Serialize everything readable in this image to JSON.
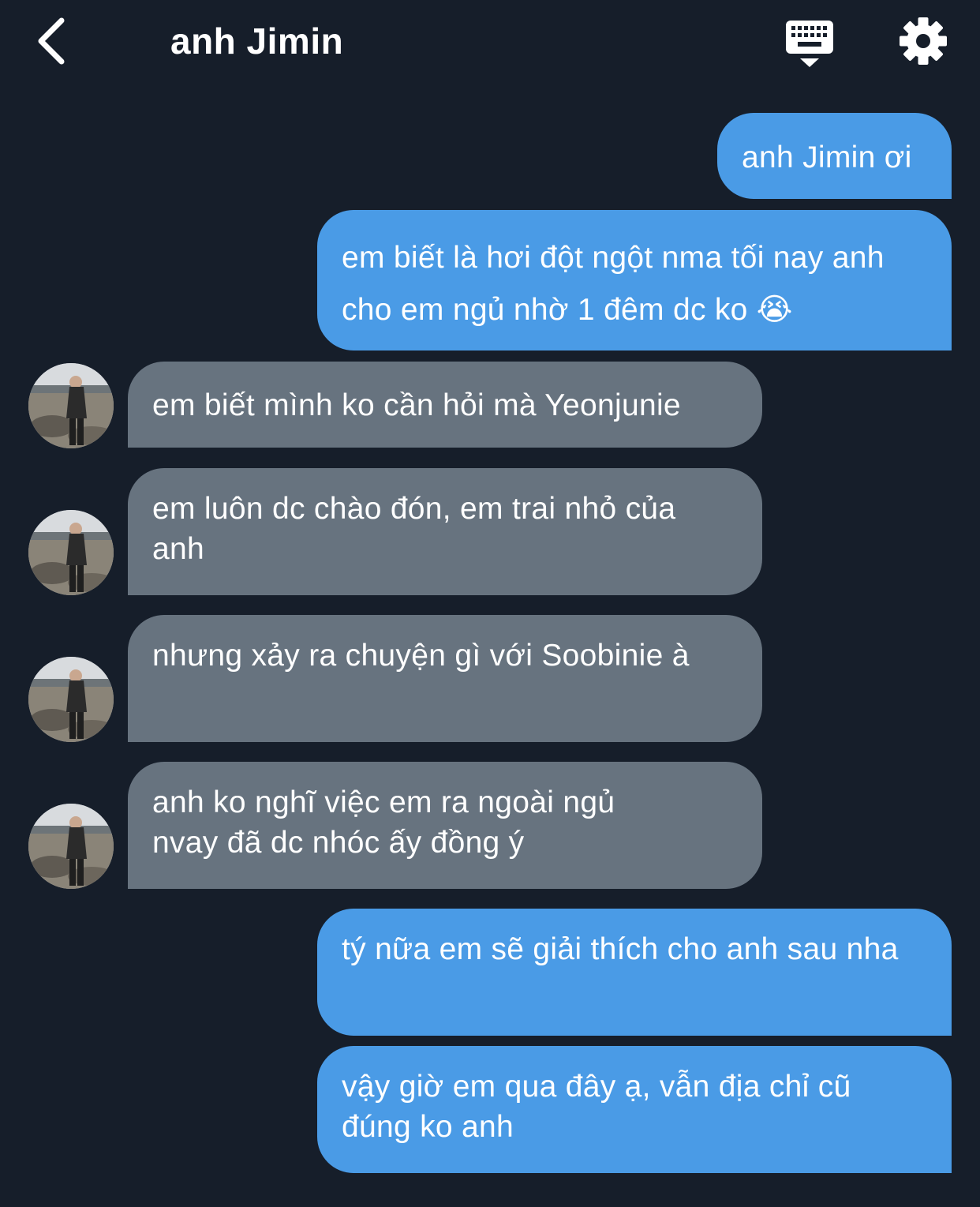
{
  "header": {
    "title": "anh Jimin",
    "back_icon": "chevron-left-icon",
    "keyboard_icon": "keyboard-hide-icon",
    "settings_icon": "gear-icon"
  },
  "colors": {
    "background": "#161e2a",
    "outgoing_bubble": "#4a9be6",
    "incoming_bubble": "#67737f",
    "text": "#ffffff"
  },
  "messages": [
    {
      "side": "out",
      "text": "anh Jimin ơi"
    },
    {
      "side": "out",
      "text": "em biết là hơi đột ngột nma tối nay anh cho em ngủ nhờ 1 đêm dc ko 😭"
    },
    {
      "side": "in",
      "text": "em biết mình ko cần hỏi mà Yeonjunie"
    },
    {
      "side": "in",
      "text": "em luôn dc chào đón, em trai nhỏ của anh"
    },
    {
      "side": "in",
      "text": "nhưng xảy ra chuyện gì với Soobinie à"
    },
    {
      "side": "in",
      "text": "anh ko nghĩ việc em ra ngoài ngủ nvay đã dc nhóc ấy đồng ý"
    },
    {
      "side": "out",
      "text": "tý nữa em sẽ giải thích cho anh sau nha"
    },
    {
      "side": "out",
      "text": "vậy giờ em qua đây ạ, vẫn địa chỉ cũ đúng ko anh"
    }
  ]
}
